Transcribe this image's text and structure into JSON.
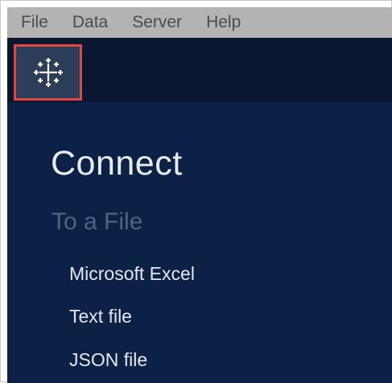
{
  "menu": {
    "items": [
      "File",
      "Data",
      "Server",
      "Help"
    ]
  },
  "toolbar": {
    "logo_icon": "tableau-logo-icon",
    "highlight_color": "#e0473d"
  },
  "connect": {
    "title": "Connect",
    "section_title": "To a File",
    "connectors": [
      "Microsoft Excel",
      "Text file",
      "JSON file"
    ]
  },
  "colors": {
    "menubar_bg": "#b3b3b3",
    "toolbar_bg": "#0a1730",
    "panel_bg": "#0b2146",
    "logo_tile_bg": "#2d3e5a"
  }
}
